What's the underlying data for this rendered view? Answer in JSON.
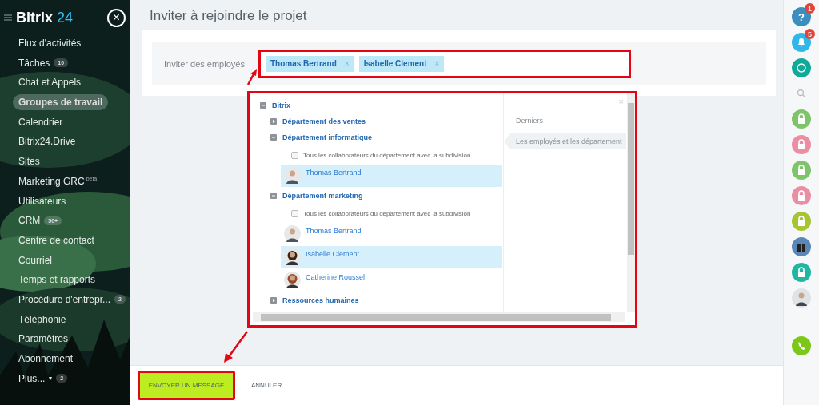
{
  "sidebar": {
    "logo": {
      "name": "Bitrix",
      "suffix": "24"
    },
    "close": "×",
    "items": [
      {
        "label": "Flux d'activités",
        "selected": false
      },
      {
        "label": "Tâches",
        "badge": "10",
        "selected": false
      },
      {
        "label": "Chat et Appels",
        "selected": false
      },
      {
        "label": "Groupes de travail",
        "selected": true
      },
      {
        "label": "Calendrier",
        "selected": false
      },
      {
        "label": "Bitrix24.Drive",
        "selected": false
      },
      {
        "label": "Sites",
        "selected": false
      },
      {
        "label": "Marketing GRC",
        "sup": "beta",
        "selected": false
      },
      {
        "label": "Utilisateurs",
        "selected": false
      },
      {
        "label": "CRM",
        "badge": "50+",
        "selected": false
      },
      {
        "label": "Centre de contact",
        "selected": false
      },
      {
        "label": "Courriel",
        "selected": false
      },
      {
        "label": "Temps et rapports",
        "selected": false
      },
      {
        "label": "Procédure d'entrepr...",
        "badge": "2",
        "selected": false
      },
      {
        "label": "Téléphonie",
        "selected": false
      },
      {
        "label": "Paramètres",
        "selected": false
      },
      {
        "label": "Abonnement",
        "selected": false
      },
      {
        "label": "Plus...",
        "caret": "▾",
        "badge": "2",
        "selected": false
      }
    ]
  },
  "page": {
    "title": "Inviter à rejoindre le projet",
    "invite": {
      "label": "Inviter des employés",
      "tokens": [
        {
          "name": "Thomas Bertrand",
          "remove": "×"
        },
        {
          "name": "Isabelle Clement",
          "remove": "×"
        }
      ]
    },
    "popup": {
      "close": "×",
      "tree": [
        {
          "label": "Bitrix",
          "expanded": true,
          "children": [
            {
              "label": "Département des ventes",
              "expanded": false
            },
            {
              "label": "Département informatique",
              "expanded": true,
              "children": [
                {
                  "kind": "checkbox",
                  "label": "Tous les collaborateurs du département avec la subdivision",
                  "checked": false
                },
                {
                  "kind": "employee",
                  "label": "Thomas Bertrand",
                  "selected": true
                }
              ]
            },
            {
              "label": "Département marketing",
              "expanded": true,
              "children": [
                {
                  "kind": "checkbox",
                  "label": "Tous les collaborateurs du département avec la subdivision",
                  "checked": false
                },
                {
                  "kind": "employee",
                  "label": "Thomas Bertrand",
                  "selected": false
                },
                {
                  "kind": "employee",
                  "label": "Isabelle Clement",
                  "selected": true
                },
                {
                  "kind": "employee",
                  "label": "Catherine Roussel",
                  "selected": false
                }
              ]
            },
            {
              "label": "Ressources humaines",
              "expanded": false
            }
          ]
        }
      ],
      "tabs": [
        {
          "label": "Derniers",
          "selected": false
        },
        {
          "label": "Les employés et les département",
          "selected": true
        }
      ]
    },
    "actions": [
      {
        "label": "ENVOYER UN MESSAGE",
        "kind": "primary"
      },
      {
        "label": "ANNULER",
        "kind": "link"
      }
    ]
  },
  "rightbar": [
    {
      "kind": "help",
      "glyph": "?",
      "badge": "1"
    },
    {
      "kind": "bell",
      "badge": "5"
    },
    {
      "kind": "chat"
    },
    {
      "kind": "search"
    },
    {
      "kind": "lock",
      "color": "#7dc46b"
    },
    {
      "kind": "lock",
      "color": "#e98ea3"
    },
    {
      "kind": "lock",
      "color": "#7dc46b"
    },
    {
      "kind": "lock",
      "color": "#e98ea3"
    },
    {
      "kind": "lock",
      "color": "#a7c432"
    },
    {
      "kind": "avatar"
    },
    {
      "kind": "lock",
      "color": "#1fb7a1"
    },
    {
      "kind": "person"
    },
    {
      "kind": "phone"
    }
  ]
}
